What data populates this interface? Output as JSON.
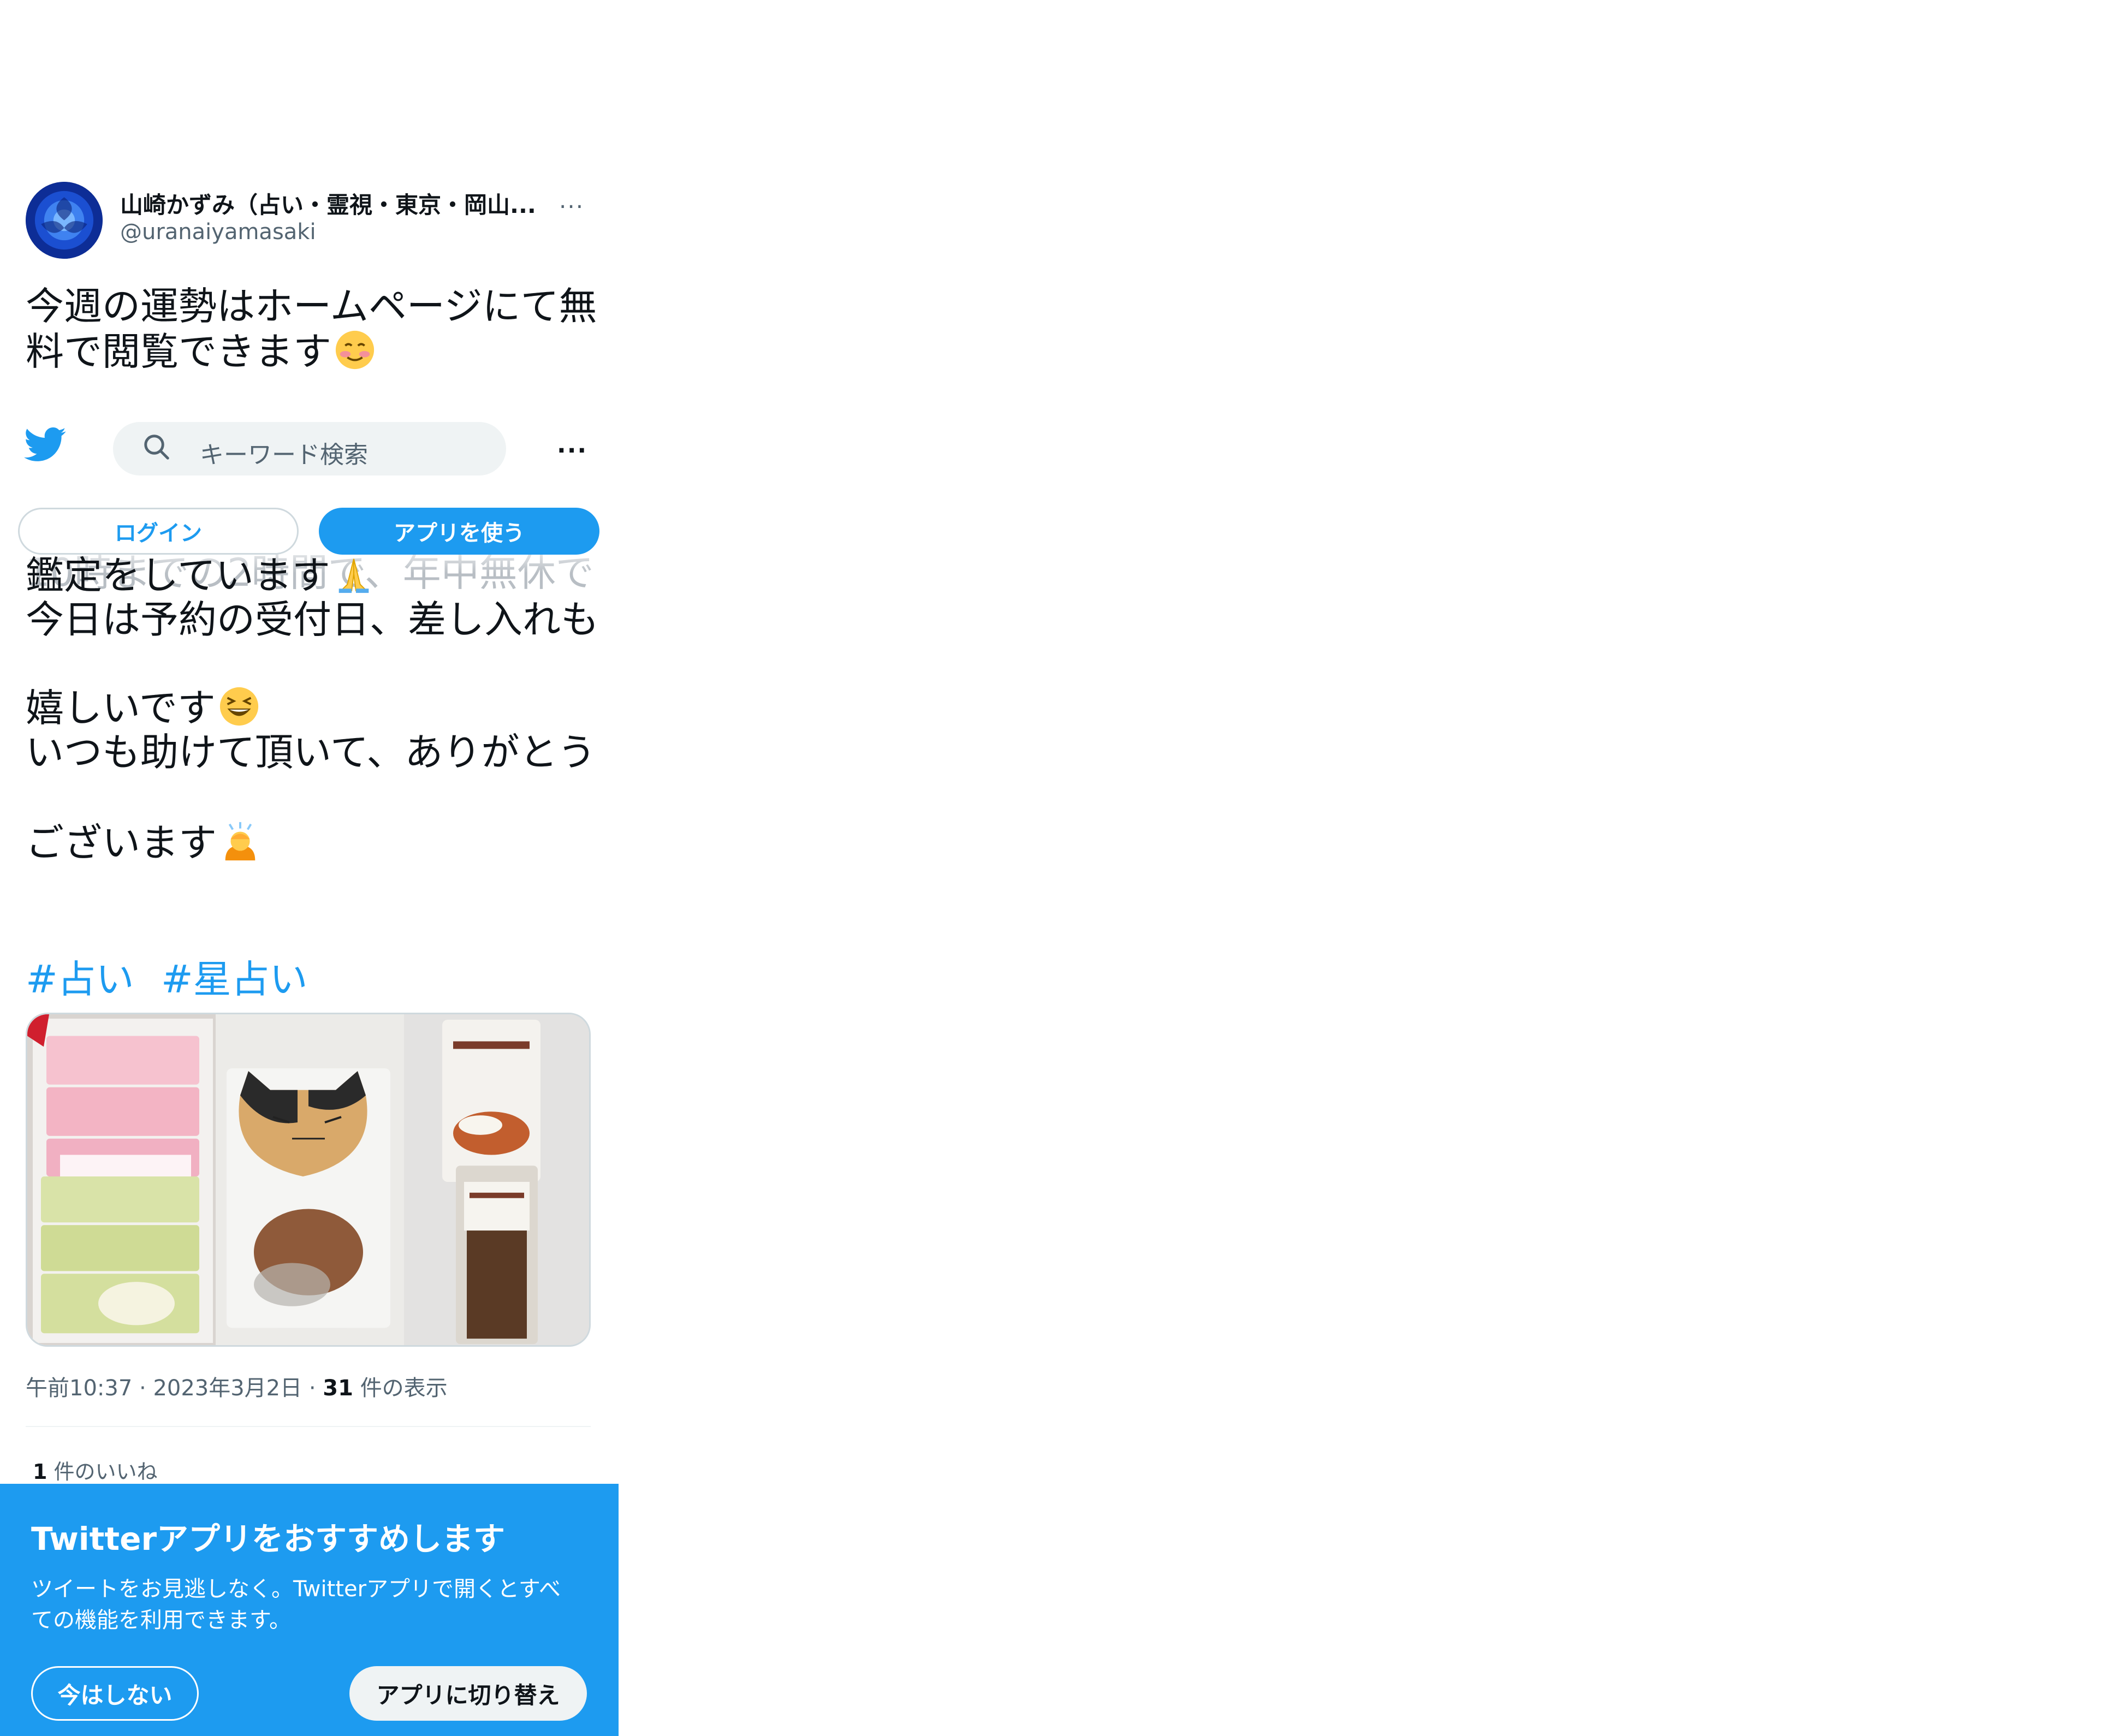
{
  "author": {
    "name": "山崎かずみ（占い・霊視・東京・岡山...",
    "handle": "@uranaiyamasaki",
    "more_label": "···"
  },
  "tweet": {
    "line_1": "今週の運勢はホームページにて無",
    "line_2": "料で閲覧できます",
    "ghost_line": "10時までの2時間で、年中無休で",
    "line_3": "鑑定をしています",
    "line_4": "今日は予約の受付日、差し入れも",
    "line_5": "嬉しいです",
    "line_6": "いつも助けて頂いて、ありがとう",
    "line_7": "ございます",
    "hashtags": [
      "#占い",
      "#星占い"
    ]
  },
  "emoji": {
    "smile": "smiling-face-icon",
    "pray": "folded-hands-icon",
    "laugh": "grinning-squinting-face-icon",
    "bow": "person-bowing-icon"
  },
  "topbar": {
    "search_placeholder": "キーワード検索",
    "more_label": "···"
  },
  "auth": {
    "login_label": "ログイン",
    "app_label": "アプリを使う"
  },
  "meta": {
    "time": "午前10:37",
    "date": "2023年3月2日",
    "views_count": "31",
    "views_label": "件の表示"
  },
  "likes": {
    "count": "1",
    "label": "件のいいね"
  },
  "banner": {
    "title": "Twitterアプリをおすすめします",
    "body_1": "ツイートをお見逃しなく。Twitterアプリで開くとすべ",
    "body_2": "ての機能を利用できます。",
    "not_now_label": "今はしない",
    "switch_label": "アプリに切り替え"
  },
  "colors": {
    "accent": "#1d9bf0",
    "text": "#0f1419",
    "muted": "#536471"
  }
}
